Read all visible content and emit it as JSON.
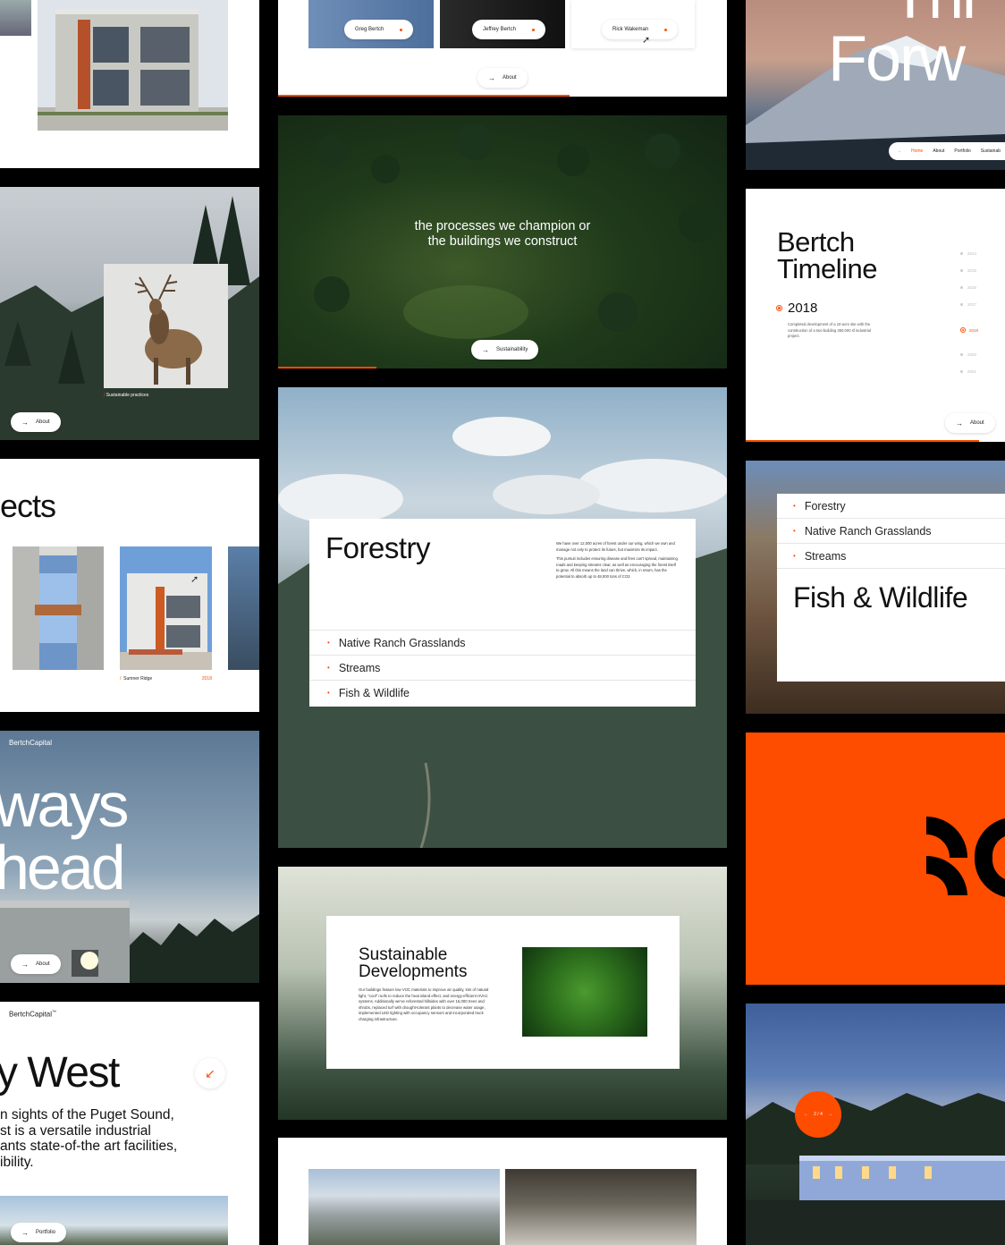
{
  "team": {
    "members": [
      "Greg Bertch",
      "Jeffrey Bertch",
      "Rick Wakeman"
    ],
    "about_button": "About",
    "progress": 0.65
  },
  "processes": {
    "tagline_line1": "the processes we champion or",
    "tagline_line2": "the buildings we construct",
    "button": "Sustainability",
    "progress": 0.22
  },
  "hero_top": {
    "title_fragment_1": "Thi",
    "title_fragment_2": "Forw",
    "nav": [
      "Home",
      "About",
      "Portfolio",
      "Sustainab"
    ]
  },
  "elk": {
    "caption": "Sustainable practices",
    "button": "About"
  },
  "timeline": {
    "title_line1": "Bertch",
    "title_line2": "Timeline",
    "year": "2018",
    "description": "Completed development of a 10-acre site with the construction of a two-building 350,000 sf industrial project.",
    "years": [
      "2014",
      "2015",
      "2016",
      "2017",
      "2018",
      "2020",
      "2021"
    ],
    "active_year": "2018",
    "button": "About",
    "progress": 0.9
  },
  "projects": {
    "title_fragment": "ects",
    "caption_name": "Sumner Ridge",
    "caption_year": "2018",
    "caption_slash": "/"
  },
  "forestry": {
    "title": "Forestry",
    "paragraph1": "We have over 12,000 acres of forest under our wing, which we own and manage not only to protect its future, but maximize its impact.",
    "paragraph2": "This pursuit includes ensuring disease and fires can't spread, maintaining roads and keeping streams clear, as well as encouraging the forest itself to grow. All this means the land can thrive, which, in return, has the potential to absorb up to 48,000 tons of CO2.",
    "items": [
      "Native Ranch Grasslands",
      "Streams",
      "Fish & Wildlife"
    ]
  },
  "wildlife": {
    "items": [
      "Forestry",
      "Native Ranch Grasslands",
      "Streams"
    ],
    "title": "Fish & Wildlife"
  },
  "always": {
    "brand": "BertchCapital",
    "line1": "ways",
    "line2": "head",
    "button": "About"
  },
  "sustainable": {
    "title_line1": "Sustainable",
    "title_line2": "Developments",
    "body": "Our buildings feature low VOC materials to improve air quality, lots of natural light, \"cool\" roofs to reduce the heat island effect, and energy-efficient HVAC systems. Additionally we've reforested hillsides with over 16,000 trees and shrubs, replaced turf with drought-tolerant plants to decrease water usage, implemented LED lighting with occupancy sensors and incorporated truck charging infrastructure."
  },
  "west": {
    "brand": "BertchCapital",
    "brand_mark": "™",
    "title": "y West",
    "body_line1": "n sights of the Puget Sound,",
    "body_line2": "st is a versatile industrial",
    "body_line3": "ants state-of-the art facilities,",
    "body_line4": "ibility.",
    "button": "Portfolio"
  },
  "slider": {
    "counter": "2 / 4",
    "prev": "←",
    "next": "→"
  },
  "colors": {
    "accent": "#ff4d00",
    "black": "#000000",
    "white": "#ffffff"
  }
}
